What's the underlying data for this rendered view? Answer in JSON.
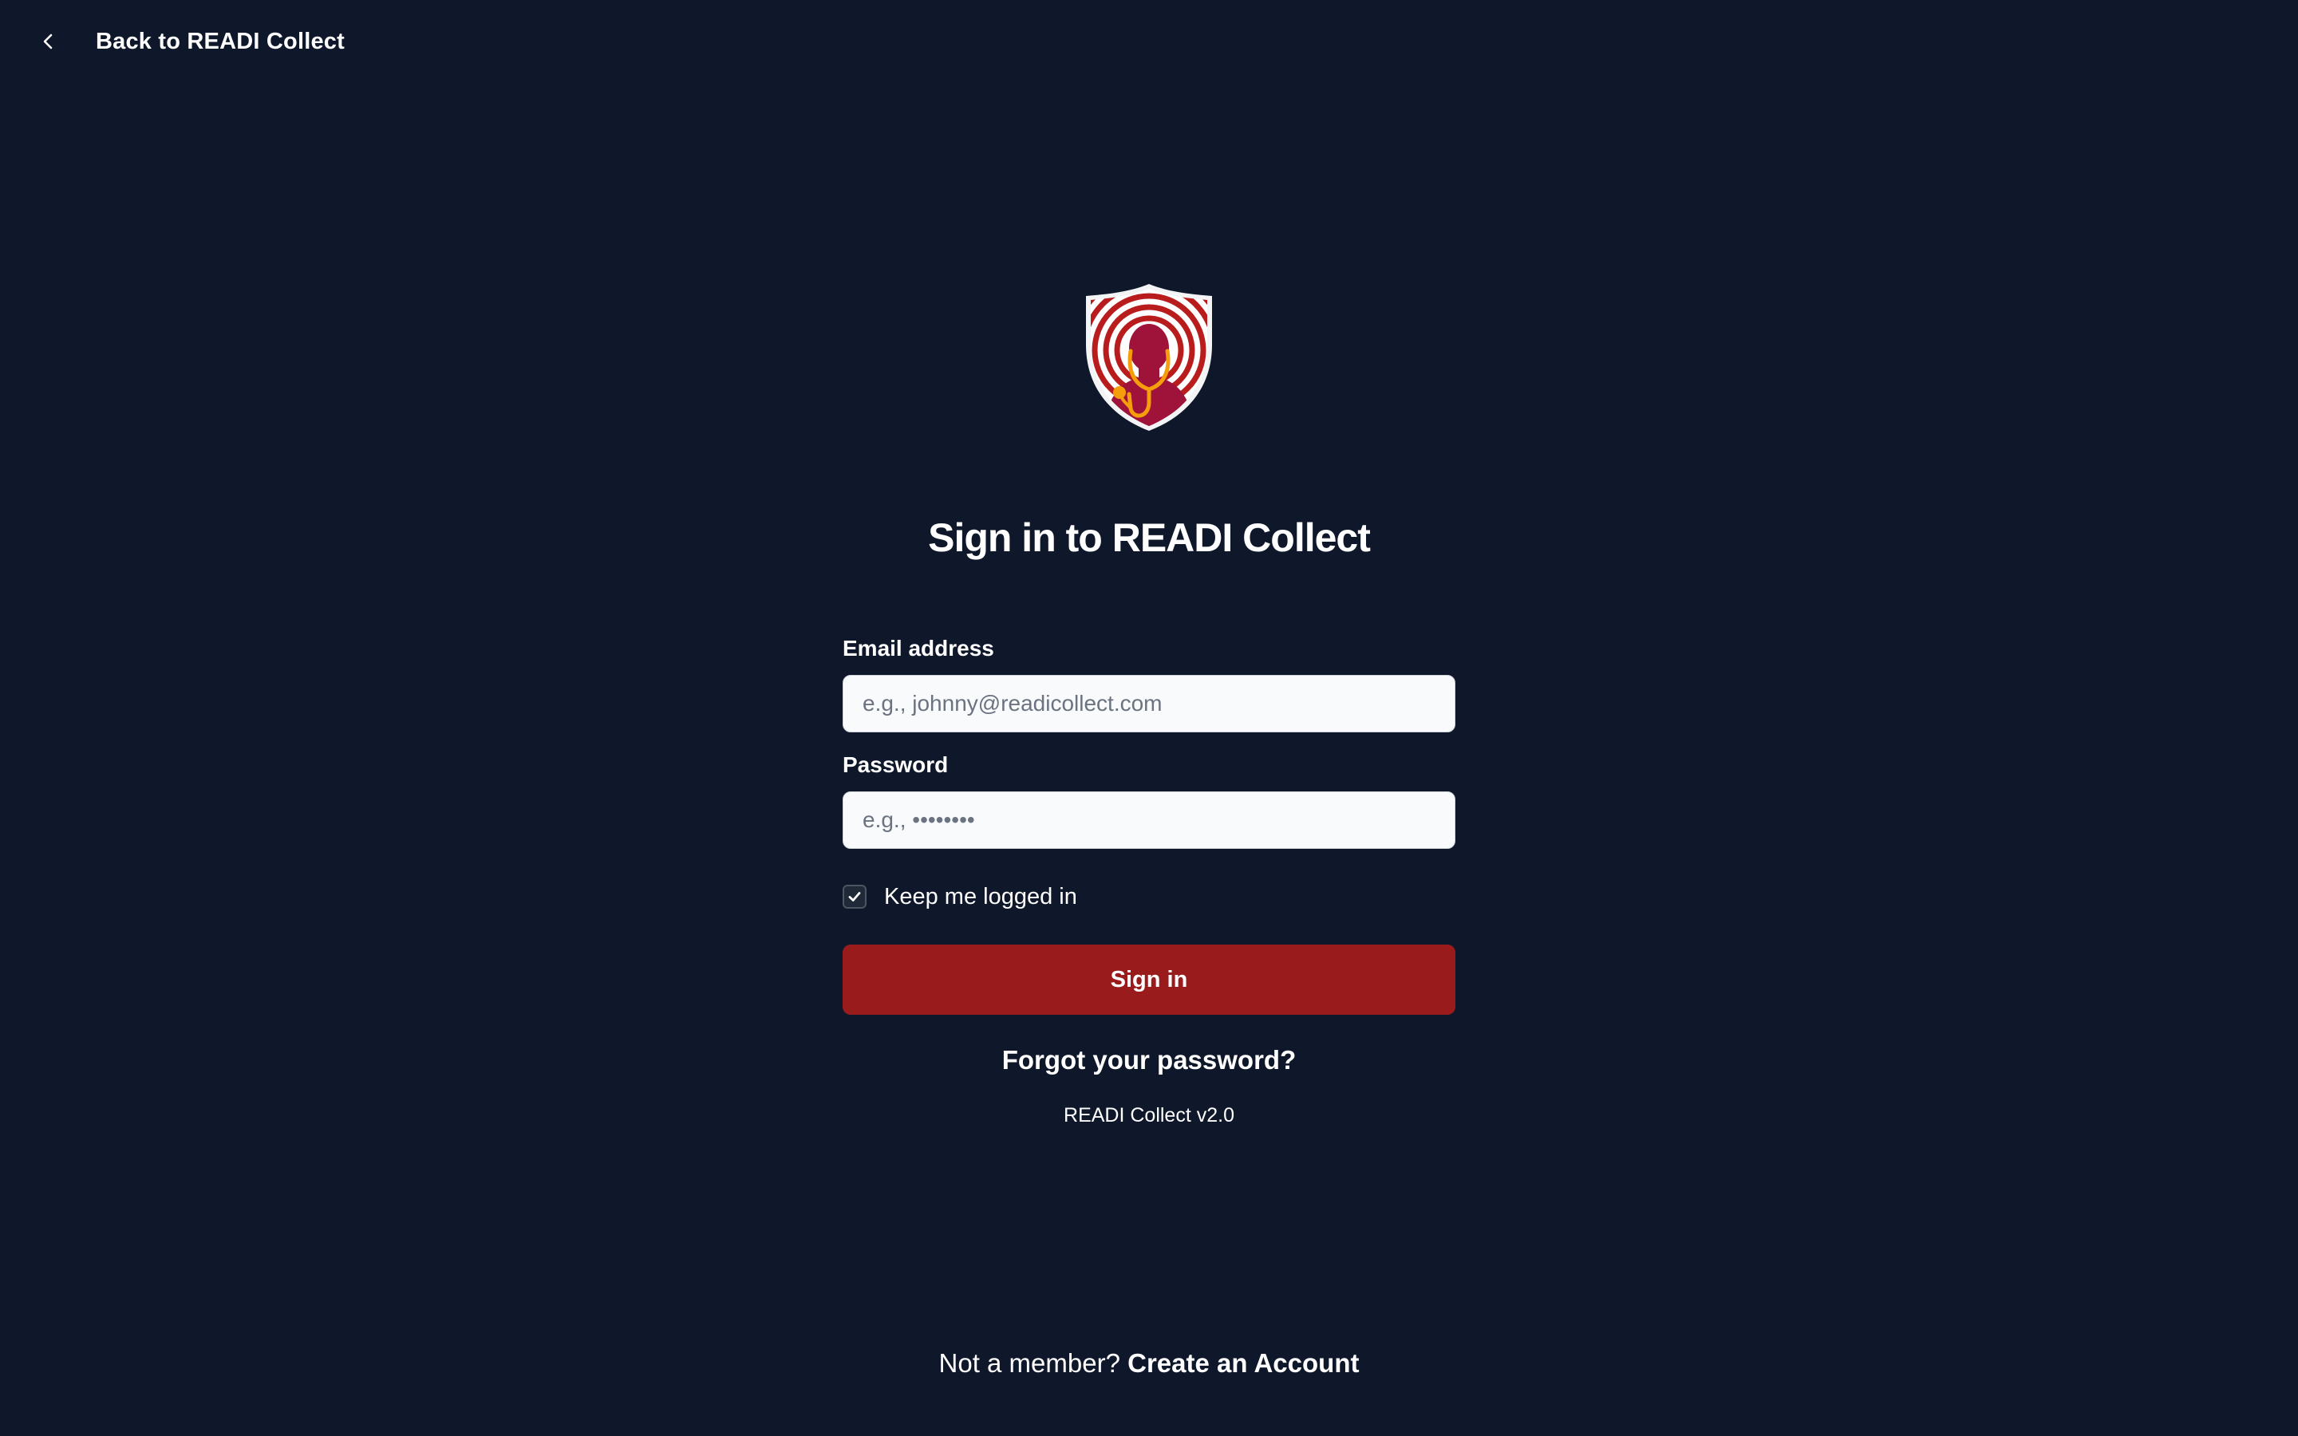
{
  "nav": {
    "back_label": "Back to READI Collect",
    "back_icon": "chevron-left-icon"
  },
  "logo": {
    "icon": "shield-doctor-stethoscope-logo",
    "colors": {
      "shield_fill": "#ffffff",
      "rings": "#b91c1c",
      "figure": "#9f1239",
      "stethoscope": "#f59e0b"
    }
  },
  "title": "Sign in to READI Collect",
  "form": {
    "email_label": "Email address",
    "email_placeholder": "e.g., johnny@readicollect.com",
    "email_value": "",
    "password_label": "Password",
    "password_placeholder": "e.g., ••••••••",
    "password_value": "",
    "keep_logged_in_label": "Keep me logged in",
    "keep_logged_in_checked": true,
    "signin_label": "Sign in",
    "forgot_label": "Forgot your password?",
    "version": "READI Collect v2.0"
  },
  "footer": {
    "prompt": "Not a member?",
    "create_label": "Create an Account"
  },
  "colors": {
    "background": "#0f172a",
    "primary_button": "#991b1b",
    "text": "#ffffff"
  }
}
